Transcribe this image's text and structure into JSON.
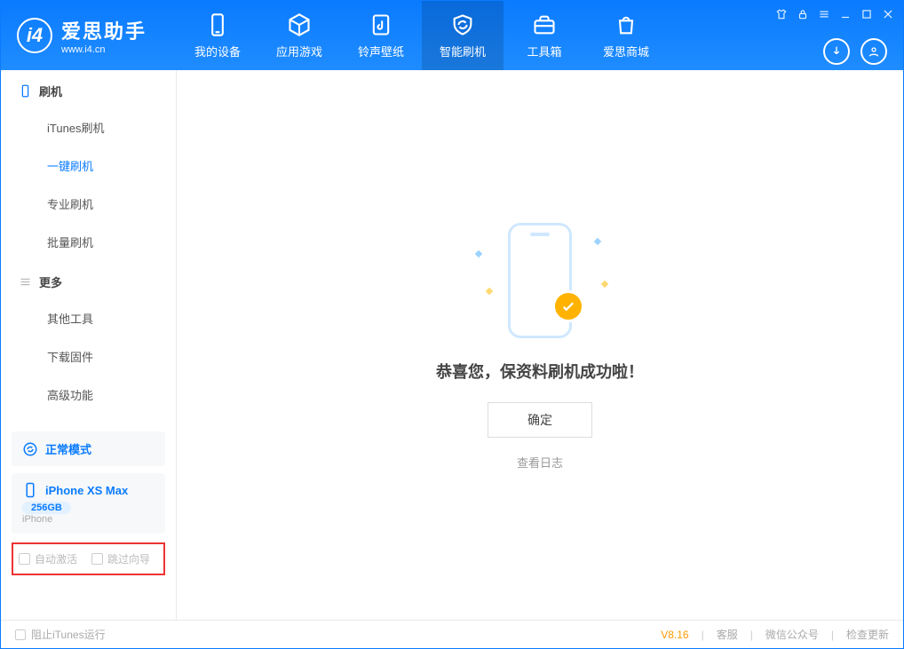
{
  "brand": {
    "name": "爱思助手",
    "site": "www.i4.cn"
  },
  "nav": {
    "tabs": [
      {
        "label": "我的设备"
      },
      {
        "label": "应用游戏"
      },
      {
        "label": "铃声壁纸"
      },
      {
        "label": "智能刷机"
      },
      {
        "label": "工具箱"
      },
      {
        "label": "爱思商城"
      }
    ]
  },
  "sidebar": {
    "group1_title": "刷机",
    "group1_items": [
      {
        "label": "iTunes刷机"
      },
      {
        "label": "一键刷机"
      },
      {
        "label": "专业刷机"
      },
      {
        "label": "批量刷机"
      }
    ],
    "group2_title": "更多",
    "group2_items": [
      {
        "label": "其他工具"
      },
      {
        "label": "下载固件"
      },
      {
        "label": "高级功能"
      }
    ],
    "mode_label": "正常模式",
    "device_name": "iPhone XS Max",
    "device_capacity": "256GB",
    "device_type": "iPhone",
    "cb_auto_activate": "自动激活",
    "cb_skip_guide": "跳过向导"
  },
  "main": {
    "success_text": "恭喜您，保资料刷机成功啦！",
    "ok_button": "确定",
    "log_link": "查看日志"
  },
  "footer": {
    "block_itunes": "阻止iTunes运行",
    "version": "V8.16",
    "links": {
      "support": "客服",
      "wechat": "微信公众号",
      "update": "检查更新"
    }
  }
}
